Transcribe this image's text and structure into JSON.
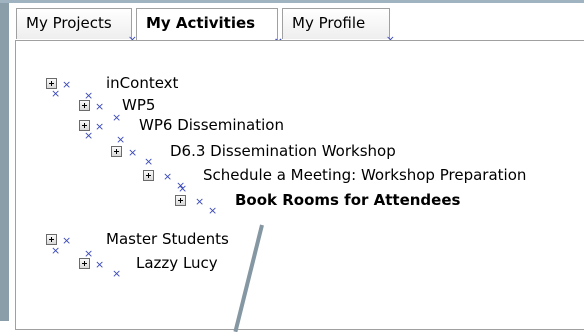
{
  "tabs": [
    {
      "label": "My Projects",
      "active": false
    },
    {
      "label": "My Activities",
      "active": true
    },
    {
      "label": "My Profile",
      "active": false
    }
  ],
  "tree": [
    {
      "label": "inContext",
      "level": 0,
      "bold": false
    },
    {
      "label": "WP5",
      "level": 1,
      "bold": false
    },
    {
      "label": "WP6 Dissemination",
      "level": 1,
      "bold": false
    },
    {
      "label": "D6.3 Dissemination Workshop",
      "level": 2,
      "bold": false
    },
    {
      "label": "Schedule a Meeting: Workshop Preparation",
      "level": 3,
      "bold": false
    },
    {
      "label": "Book Rooms for Attendees",
      "level": 4,
      "bold": true
    },
    {
      "label": "Master Students",
      "level": 0,
      "bold": false
    },
    {
      "label": "Lazzy Lucy",
      "level": 1,
      "bold": false
    }
  ],
  "icons": {
    "expand": "plus-box-icon",
    "marker": "cross-marker-icon"
  },
  "colors": {
    "marker": "#3b4ab8",
    "frame": "#8a9ea9"
  }
}
